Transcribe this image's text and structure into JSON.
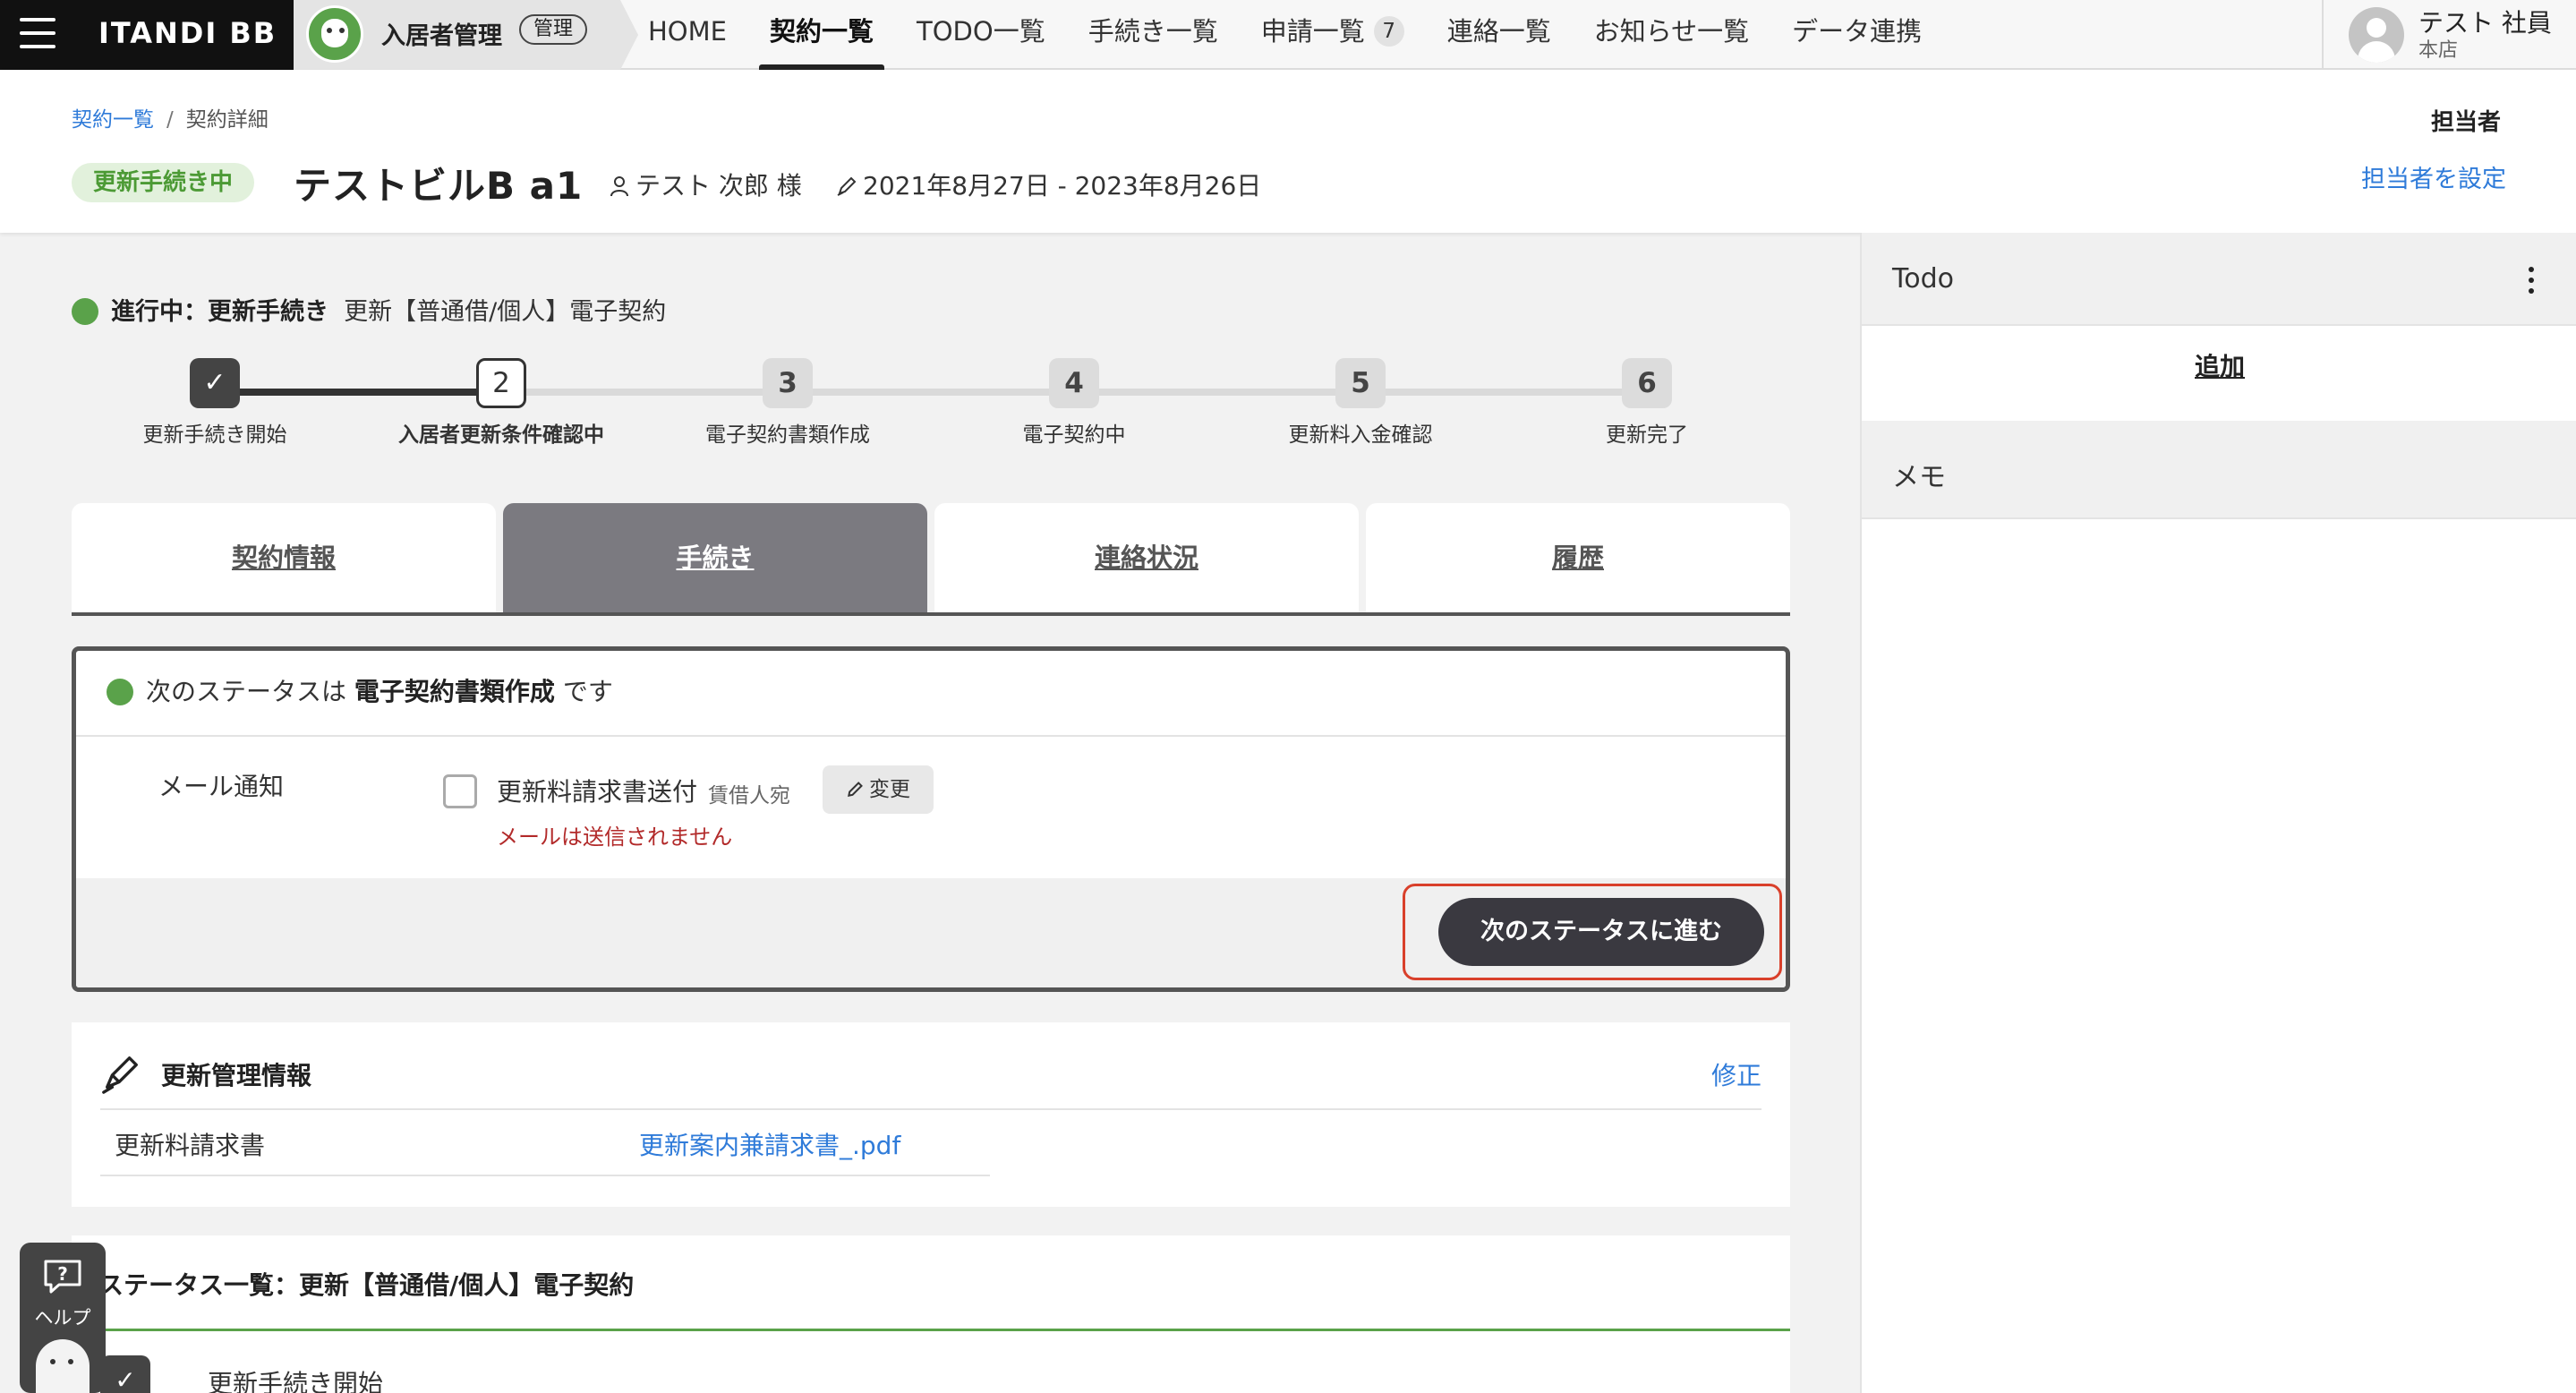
{
  "topbar": {
    "brand": "ITANDI BB",
    "app_title": "入居者管理",
    "app_badge": "管理",
    "nav": [
      {
        "label": "HOME"
      },
      {
        "label": "契約一覧",
        "active": true
      },
      {
        "label": "TODO一覧"
      },
      {
        "label": "手続き一覧"
      },
      {
        "label": "申請一覧",
        "count": "7"
      },
      {
        "label": "連絡一覧"
      },
      {
        "label": "お知らせ一覧"
      },
      {
        "label": "データ連携"
      }
    ],
    "user": {
      "name": "テスト 社員",
      "branch": "本店"
    }
  },
  "header": {
    "breadcrumb": {
      "parent": "契約一覧",
      "separator": "/",
      "current": "契約詳細"
    },
    "status": "更新手続き中",
    "property_name": "テストビルB a1",
    "tenant": "テスト 次郎 様",
    "period": "2021年8月27日 - 2023年8月26日",
    "owner_label": "担当者",
    "owner_link": "担当者を設定"
  },
  "progress": {
    "prefix": "進行中：更新手続き",
    "contract_type": "更新【普通借/個人】電子契約",
    "steps": [
      {
        "number": "✓",
        "label": "更新手続き開始",
        "state": "done"
      },
      {
        "number": "2",
        "label": "入居者更新条件確認中",
        "state": "current"
      },
      {
        "number": "3",
        "label": "電子契約書類作成",
        "state": "pending"
      },
      {
        "number": "4",
        "label": "電子契約中",
        "state": "pending"
      },
      {
        "number": "5",
        "label": "更新料入金確認",
        "state": "pending"
      },
      {
        "number": "6",
        "label": "更新完了",
        "state": "pending"
      }
    ]
  },
  "tabs": [
    {
      "label": "契約情報"
    },
    {
      "label": "手続き",
      "active": true
    },
    {
      "label": "連絡状況"
    },
    {
      "label": "履歴"
    }
  ],
  "status_panel": {
    "prefix": "次のステータスは",
    "next_status": "電子契約書類作成",
    "suffix": "です",
    "mail_label": "メール通知",
    "mail_item": "更新料請求書送付",
    "mail_target": "賃借人宛",
    "change_button": "変更",
    "mail_warning": "メールは送信されません",
    "next_button": "次のステータスに進む"
  },
  "management": {
    "title": "更新管理情報",
    "edit": "修正",
    "key": "更新料請求書",
    "value": "更新案内兼請求書_.pdf"
  },
  "status_list": {
    "title": "ステータス一覧：更新【普通借/個人】電子契約",
    "first_item": "更新手続き開始"
  },
  "side": {
    "todo_title": "Todo",
    "todo_add": "追加",
    "memo_title": "メモ"
  },
  "help": {
    "label": "ヘルプ"
  },
  "colors": {
    "accent_green": "#5aa24a",
    "link_blue": "#2f7bd9",
    "warning_red": "#b22a2a",
    "highlight_outline": "#d9402b"
  }
}
